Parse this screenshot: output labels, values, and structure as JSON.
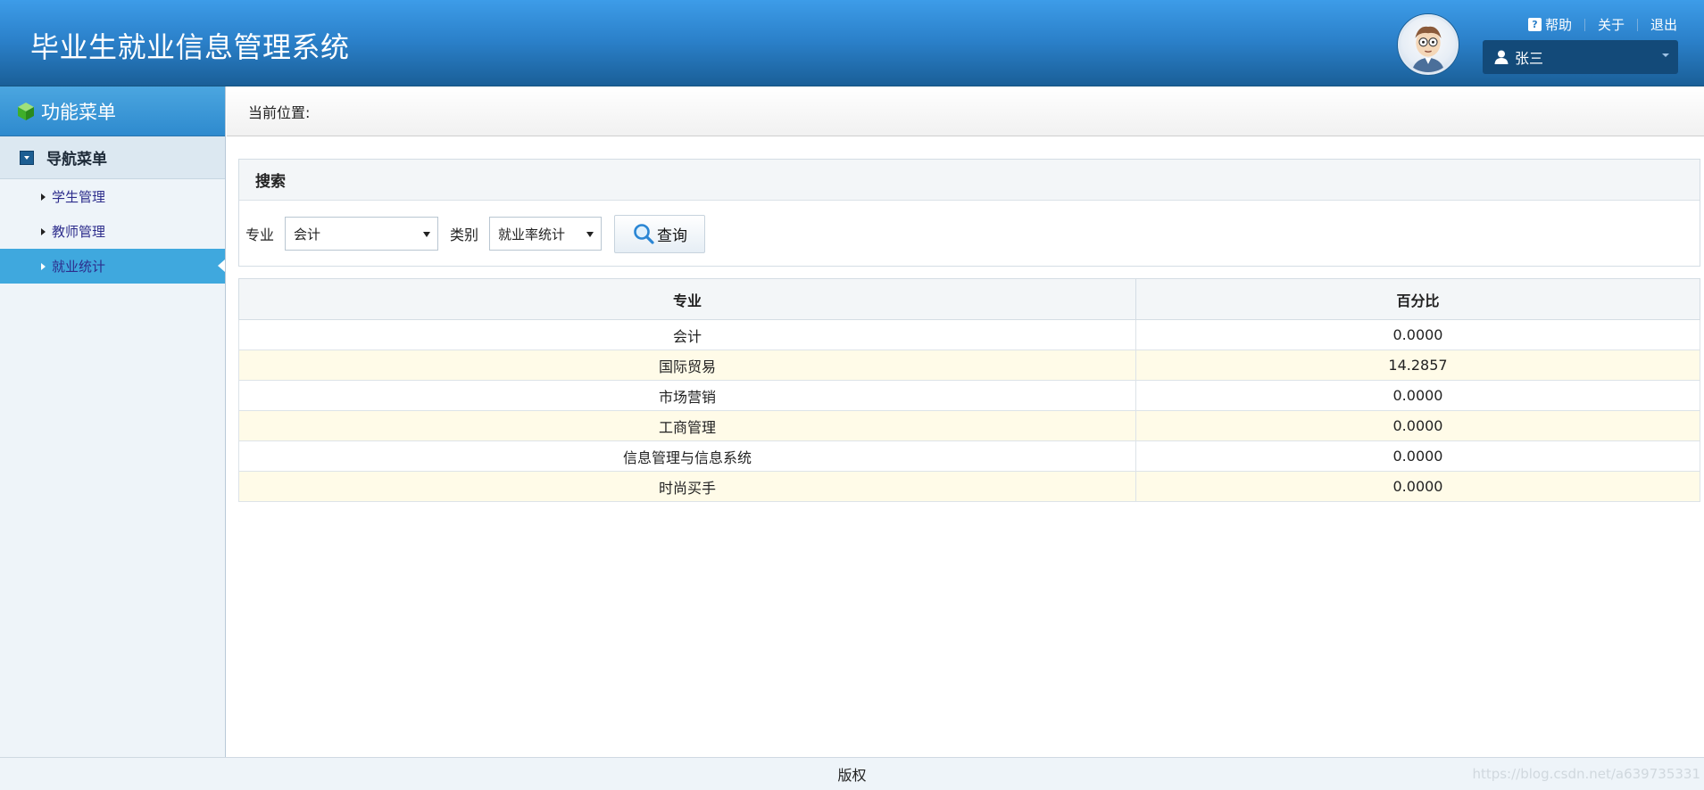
{
  "header": {
    "title": "毕业生就业信息管理系统",
    "links": {
      "help": "帮助",
      "about": "关于",
      "logout": "退出"
    },
    "user": {
      "name": "张三"
    }
  },
  "sidebar": {
    "title": "功能菜单",
    "group": "导航菜单",
    "items": [
      {
        "label": "学生管理",
        "active": false
      },
      {
        "label": "教师管理",
        "active": false
      },
      {
        "label": "就业统计",
        "active": true
      }
    ]
  },
  "breadcrumb": {
    "label": "当前位置:"
  },
  "search": {
    "title": "搜索",
    "major_label": "专业",
    "major_value": "会计",
    "category_label": "类别",
    "category_value": "就业率统计",
    "query_button": "查询"
  },
  "table": {
    "headers": [
      "专业",
      "百分比"
    ],
    "rows": [
      [
        "会计",
        "0.0000"
      ],
      [
        "国际贸易",
        "14.2857"
      ],
      [
        "市场营销",
        "0.0000"
      ],
      [
        "工商管理",
        "0.0000"
      ],
      [
        "信息管理与信息系统",
        "0.0000"
      ],
      [
        "时尚买手",
        "0.0000"
      ]
    ]
  },
  "footer": {
    "label": "版权"
  },
  "watermark": "https://blog.csdn.net/a639735331",
  "colors": {
    "header": "#2a7fc8",
    "active_nav": "#3fa8de",
    "alt_row": "#fffbe8"
  }
}
